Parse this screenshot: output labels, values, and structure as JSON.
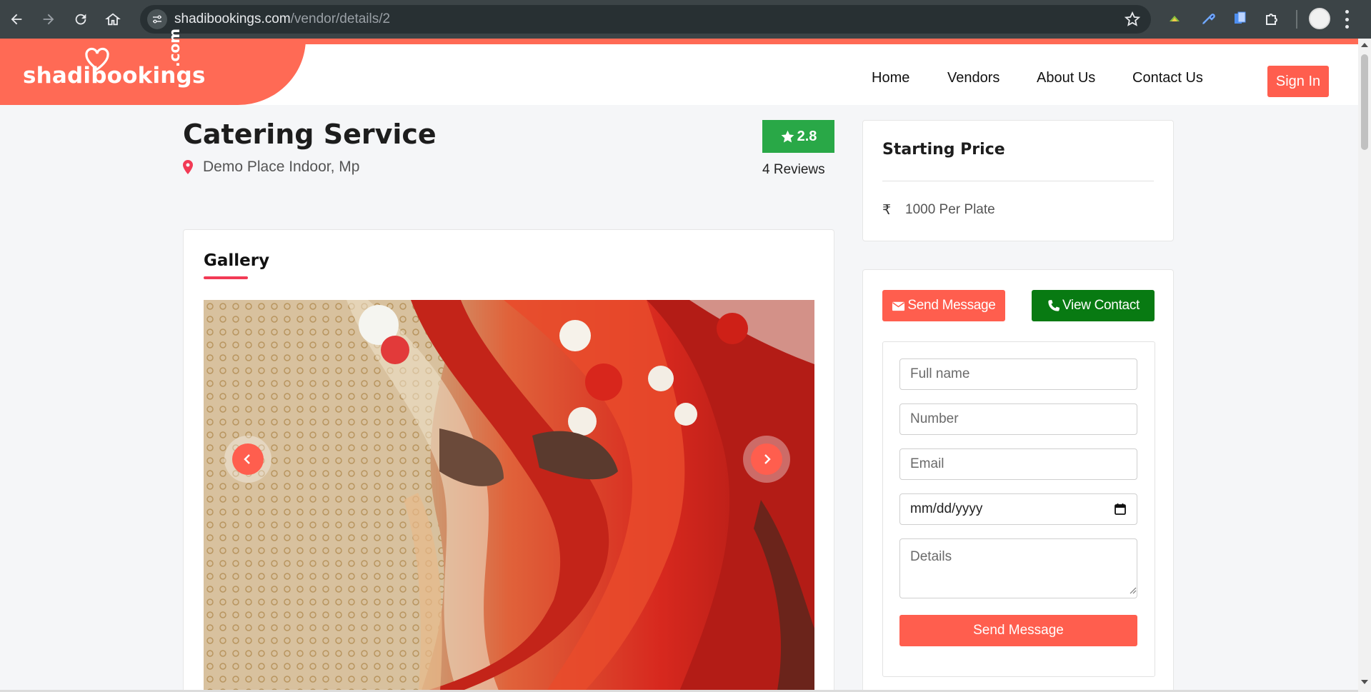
{
  "browser": {
    "url_host": "shadibookings.com",
    "url_path": "/vendor/details/2"
  },
  "site": {
    "logo_text": "shadibookings",
    "logo_suffix": ".com",
    "nav": [
      "Home",
      "Vendors",
      "About Us",
      "Contact Us"
    ],
    "signin_label": "Sign In",
    "brand_color": "#ff6a55"
  },
  "vendor": {
    "title": "Catering Service",
    "location": "Demo Place Indoor, Mp",
    "rating": "2.8",
    "reviews": "4 Reviews"
  },
  "gallery": {
    "heading": "Gallery"
  },
  "price": {
    "heading": "Starting Price",
    "currency": "₹",
    "value": "1000 Per Plate"
  },
  "contact": {
    "send_message_label": "Send Message",
    "view_contact_label": "View Contact",
    "form": {
      "fullname_placeholder": "Full name",
      "number_placeholder": "Number",
      "email_placeholder": "Email",
      "date_placeholder": "mm/dd/yyyy",
      "details_placeholder": "Details",
      "submit_label": "Send Message"
    }
  }
}
